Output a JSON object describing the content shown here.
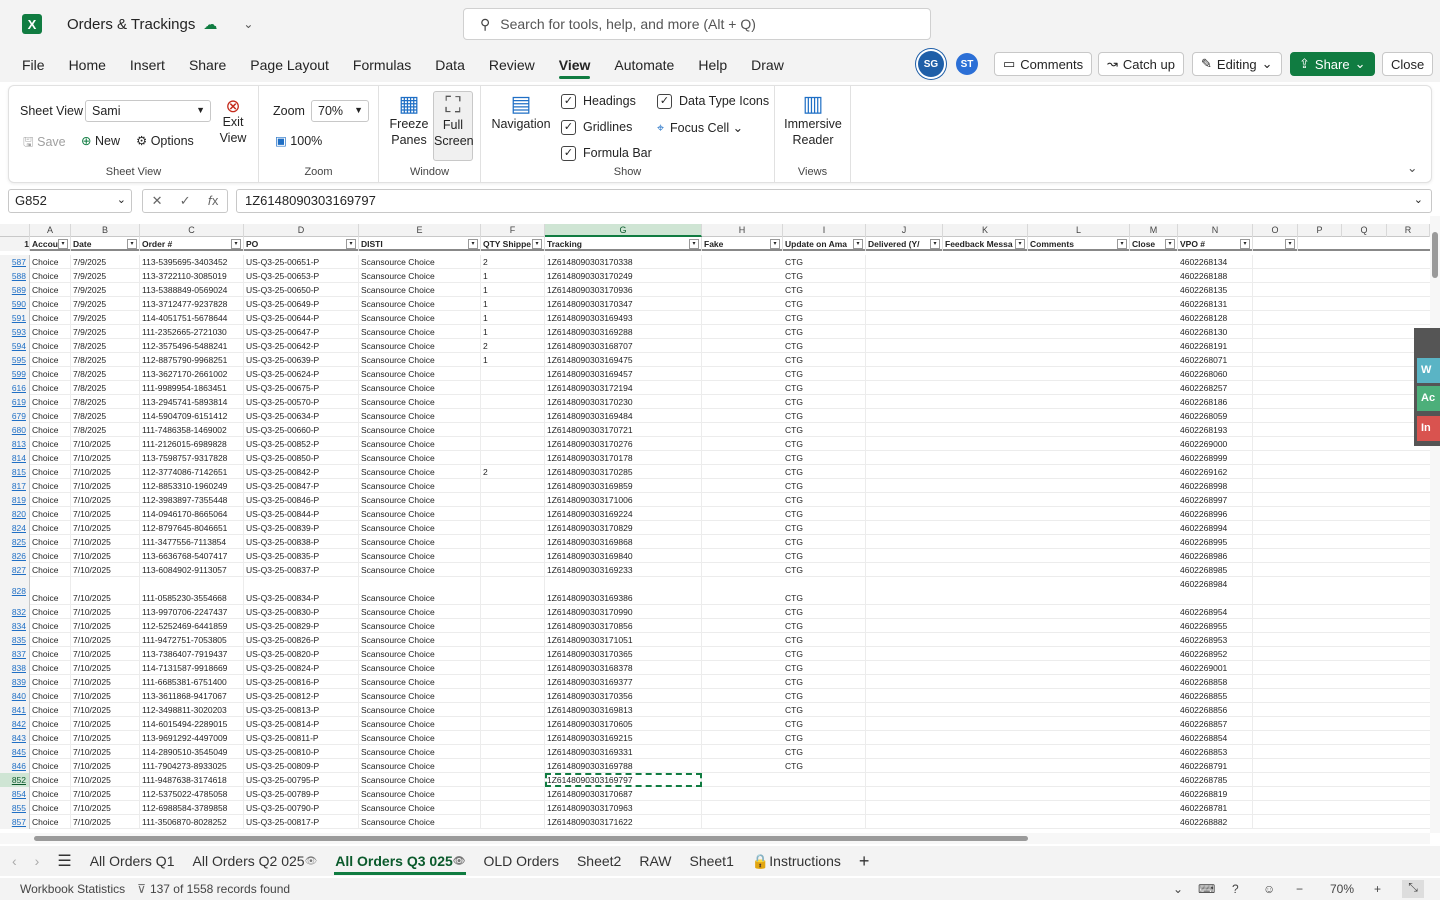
{
  "title": {
    "app_logo": "X",
    "doc_name": "Orders & Trackings"
  },
  "search": {
    "placeholder": "Search for tools, help, and more (Alt + Q)"
  },
  "menu": [
    "File",
    "Home",
    "Insert",
    "Share",
    "Page Layout",
    "Formulas",
    "Data",
    "Review",
    "View",
    "Automate",
    "Help",
    "Draw"
  ],
  "menu_active": "View",
  "header_right": {
    "avatar1": "SG",
    "avatar2": "ST",
    "comments": "Comments",
    "catchup": "Catch up",
    "editing": "Editing",
    "share": "Share",
    "close": "Close"
  },
  "ribbon": {
    "sheet_view_label": "Sheet View",
    "sheet_view_value": "Sami",
    "save": "Save",
    "new": "New",
    "options": "Options",
    "exit_view": "Exit View",
    "group_sheet_view": "Sheet View",
    "zoom_label": "Zoom",
    "zoom_value": "70%",
    "zoom_100": "100%",
    "group_zoom": "Zoom",
    "freeze": "Freeze Panes",
    "fullscreen": "Full Screen",
    "group_window": "Window",
    "navigation": "Navigation",
    "headings": "Headings",
    "gridlines": "Gridlines",
    "formula_bar": "Formula Bar",
    "data_type_icons": "Data Type Icons",
    "focus_cell": "Focus Cell",
    "group_show": "Show",
    "immersive": "Immersive Reader",
    "group_views": "Views"
  },
  "formula": {
    "name_box": "G852",
    "content": "1Z6148090303169797"
  },
  "columns": [
    "A",
    "B",
    "C",
    "D",
    "E",
    "F",
    "G",
    "H",
    "I",
    "J",
    "K",
    "L",
    "M",
    "N",
    "O",
    "P",
    "Q",
    "R"
  ],
  "selected_column": "G",
  "headers": [
    "Accou",
    "Date",
    "Order #",
    "PO",
    "DISTI",
    "QTY Shippe",
    "Tracking",
    "Fake",
    "Update on Ama",
    "Delivered (Y/",
    "Feedback Messa",
    "Comments",
    "Close",
    "VPO #",
    ""
  ],
  "rows": [
    [
      "587",
      "Choice",
      "7/9/2025",
      "113-5395695-3403452",
      "US-Q3-25-00651-P",
      "Scansource Choice",
      "2",
      "1Z6148090303170338",
      "CTG",
      "4602268134"
    ],
    [
      "588",
      "Choice",
      "7/9/2025",
      "113-3722110-3085019",
      "US-Q3-25-00653-P",
      "Scansource Choice",
      "1",
      "1Z6148090303170249",
      "CTG",
      "4602268188"
    ],
    [
      "589",
      "Choice",
      "7/9/2025",
      "113-5388849-0569024",
      "US-Q3-25-00650-P",
      "Scansource Choice",
      "1",
      "1Z6148090303170936",
      "CTG",
      "4602268135"
    ],
    [
      "590",
      "Choice",
      "7/9/2025",
      "113-3712477-9237828",
      "US-Q3-25-00649-P",
      "Scansource Choice",
      "1",
      "1Z6148090303170347",
      "CTG",
      "4602268131"
    ],
    [
      "591",
      "Choice",
      "7/9/2025",
      "114-4051751-5678644",
      "US-Q3-25-00644-P",
      "Scansource Choice",
      "1",
      "1Z6148090303169493",
      "CTG",
      "4602268128"
    ],
    [
      "593",
      "Choice",
      "7/9/2025",
      "111-2352665-2721030",
      "US-Q3-25-00647-P",
      "Scansource Choice",
      "1",
      "1Z6148090303169288",
      "CTG",
      "4602268130"
    ],
    [
      "594",
      "Choice",
      "7/8/2025",
      "112-3575496-5488241",
      "US-Q3-25-00642-P",
      "Scansource Choice",
      "2",
      "1Z6148090303168707",
      "CTG",
      "4602268191"
    ],
    [
      "595",
      "Choice",
      "7/8/2025",
      "112-8875790-9968251",
      "US-Q3-25-00639-P",
      "Scansource Choice",
      "1",
      "1Z6148090303169475",
      "CTG",
      "4602268071"
    ],
    [
      "599",
      "Choice",
      "7/8/2025",
      "113-3627170-2661002",
      "US-Q3-25-00624-P",
      "Scansource Choice",
      "",
      "1Z6148090303169457",
      "CTG",
      "4602268060"
    ],
    [
      "616",
      "Choice",
      "7/8/2025",
      "111-9989954-1863451",
      "US-Q3-25-00675-P",
      "Scansource Choice",
      "",
      "1Z6148090303172194",
      "CTG",
      "4602268257"
    ],
    [
      "619",
      "Choice",
      "7/8/2025",
      "113-2945741-5893814",
      "US-Q3-25-00570-P",
      "Scansource Choice",
      "",
      "1Z6148090303170230",
      "CTG",
      "4602268186"
    ],
    [
      "679",
      "Choice",
      "7/8/2025",
      "114-5904709-6151412",
      "US-Q3-25-00634-P",
      "Scansource Choice",
      "",
      "1Z6148090303169484",
      "CTG",
      "4602268059"
    ],
    [
      "680",
      "Choice",
      "7/8/2025",
      "111-7486358-1469002",
      "US-Q3-25-00660-P",
      "Scansource Choice",
      "",
      "1Z6148090303170721",
      "CTG",
      "4602268193"
    ],
    [
      "813",
      "Choice",
      "7/10/2025",
      "111-2126015-6989828",
      "US-Q3-25-00852-P",
      "Scansource Choice",
      "",
      "1Z6148090303170276",
      "CTG",
      "4602269000"
    ],
    [
      "814",
      "Choice",
      "7/10/2025",
      "113-7598757-9317828",
      "US-Q3-25-00850-P",
      "Scansource Choice",
      "",
      "1Z6148090303170178",
      "CTG",
      "4602268999"
    ],
    [
      "815",
      "Choice",
      "7/10/2025",
      "112-3774086-7142651",
      "US-Q3-25-00842-P",
      "Scansource Choice",
      "2",
      "1Z6148090303170285",
      "CTG",
      "4602269162"
    ],
    [
      "817",
      "Choice",
      "7/10/2025",
      "112-8853310-1960249",
      "US-Q3-25-00847-P",
      "Scansource Choice",
      "",
      "1Z6148090303169859",
      "CTG",
      "4602268998"
    ],
    [
      "819",
      "Choice",
      "7/10/2025",
      "112-3983897-7355448",
      "US-Q3-25-00846-P",
      "Scansource Choice",
      "",
      "1Z6148090303171006",
      "CTG",
      "4602268997"
    ],
    [
      "820",
      "Choice",
      "7/10/2025",
      "114-0946170-8665064",
      "US-Q3-25-00844-P",
      "Scansource Choice",
      "",
      "1Z6148090303169224",
      "CTG",
      "4602268996"
    ],
    [
      "824",
      "Choice",
      "7/10/2025",
      "112-8797645-8046651",
      "US-Q3-25-00839-P",
      "Scansource Choice",
      "",
      "1Z6148090303170829",
      "CTG",
      "4602268994"
    ],
    [
      "825",
      "Choice",
      "7/10/2025",
      "111-3477556-7113854",
      "US-Q3-25-00838-P",
      "Scansource Choice",
      "",
      "1Z6148090303169868",
      "CTG",
      "4602268995"
    ],
    [
      "826",
      "Choice",
      "7/10/2025",
      "113-6636768-5407417",
      "US-Q3-25-00835-P",
      "Scansource Choice",
      "",
      "1Z6148090303169840",
      "CTG",
      "4602268986"
    ],
    [
      "827",
      "Choice",
      "7/10/2025",
      "113-6084902-9113057",
      "US-Q3-25-00837-P",
      "Scansource Choice",
      "",
      "1Z6148090303169233",
      "CTG",
      "4602268985"
    ],
    [
      "828",
      "Choice",
      "7/10/2025",
      "111-0585230-3554668",
      "US-Q3-25-00834-P",
      "Scansource Choice",
      "",
      "1Z6148090303169386",
      "CTG",
      "4602268984"
    ],
    [
      "832",
      "Choice",
      "7/10/2025",
      "113-9970706-2247437",
      "US-Q3-25-00830-P",
      "Scansource Choice",
      "",
      "1Z6148090303170990",
      "CTG",
      "4602268954"
    ],
    [
      "834",
      "Choice",
      "7/10/2025",
      "112-5252469-6441859",
      "US-Q3-25-00829-P",
      "Scansource Choice",
      "",
      "1Z6148090303170856",
      "CTG",
      "4602268955"
    ],
    [
      "835",
      "Choice",
      "7/10/2025",
      "111-9472751-7053805",
      "US-Q3-25-00826-P",
      "Scansource Choice",
      "",
      "1Z6148090303171051",
      "CTG",
      "4602268953"
    ],
    [
      "837",
      "Choice",
      "7/10/2025",
      "113-7386407-7919437",
      "US-Q3-25-00820-P",
      "Scansource Choice",
      "",
      "1Z6148090303170365",
      "CTG",
      "4602268952"
    ],
    [
      "838",
      "Choice",
      "7/10/2025",
      "114-7131587-9918669",
      "US-Q3-25-00824-P",
      "Scansource Choice",
      "",
      "1Z6148090303168378",
      "CTG",
      "4602269001"
    ],
    [
      "839",
      "Choice",
      "7/10/2025",
      "111-6685381-6751400",
      "US-Q3-25-00816-P",
      "Scansource Choice",
      "",
      "1Z6148090303169377",
      "CTG",
      "4602268858"
    ],
    [
      "840",
      "Choice",
      "7/10/2025",
      "113-3611868-9417067",
      "US-Q3-25-00812-P",
      "Scansource Choice",
      "",
      "1Z6148090303170356",
      "CTG",
      "4602268855"
    ],
    [
      "841",
      "Choice",
      "7/10/2025",
      "112-3498811-3020203",
      "US-Q3-25-00813-P",
      "Scansource Choice",
      "",
      "1Z6148090303169813",
      "CTG",
      "4602268856"
    ],
    [
      "842",
      "Choice",
      "7/10/2025",
      "114-6015494-2289015",
      "US-Q3-25-00814-P",
      "Scansource Choice",
      "",
      "1Z6148090303170605",
      "CTG",
      "4602268857"
    ],
    [
      "843",
      "Choice",
      "7/10/2025",
      "113-9691292-4497009",
      "US-Q3-25-00811-P",
      "Scansource Choice",
      "",
      "1Z6148090303169215",
      "CTG",
      "4602268854"
    ],
    [
      "845",
      "Choice",
      "7/10/2025",
      "114-2890510-3545049",
      "US-Q3-25-00810-P",
      "Scansource Choice",
      "",
      "1Z6148090303169331",
      "CTG",
      "4602268853"
    ],
    [
      "846",
      "Choice",
      "7/10/2025",
      "111-7904273-8933025",
      "US-Q3-25-00809-P",
      "Scansource Choice",
      "",
      "1Z6148090303169788",
      "CTG",
      "4602268791"
    ],
    [
      "852",
      "Choice",
      "7/10/2025",
      "111-9487638-3174618",
      "US-Q3-25-00795-P",
      "Scansource Choice",
      "",
      "1Z6148090303169797",
      "",
      "4602268785"
    ],
    [
      "854",
      "Choice",
      "7/10/2025",
      "112-5375022-4785058",
      "US-Q3-25-00789-P",
      "Scansource Choice",
      "",
      "1Z6148090303170687",
      "",
      "4602268819"
    ],
    [
      "855",
      "Choice",
      "7/10/2025",
      "112-6988584-3789858",
      "US-Q3-25-00790-P",
      "Scansource Choice",
      "",
      "1Z6148090303170963",
      "",
      "4602268781"
    ],
    [
      "857",
      "Choice",
      "7/10/2025",
      "111-3506870-8028252",
      "US-Q3-25-00817-P",
      "Scansource Choice",
      "",
      "1Z6148090303171622",
      "",
      "4602268882"
    ]
  ],
  "side_panel": [
    "W",
    "Ac",
    "In"
  ],
  "sheet_tabs": [
    "All Orders Q1",
    "All Orders Q2 025",
    "All Orders Q3 025",
    "OLD Orders",
    "Sheet2",
    "RAW",
    "Sheet1",
    "Instructions"
  ],
  "sheet_tab_active": "All Orders Q3 025",
  "status": {
    "workbook_stats": "Workbook Statistics",
    "records": "137 of 1558 records found",
    "zoom": "70%"
  }
}
